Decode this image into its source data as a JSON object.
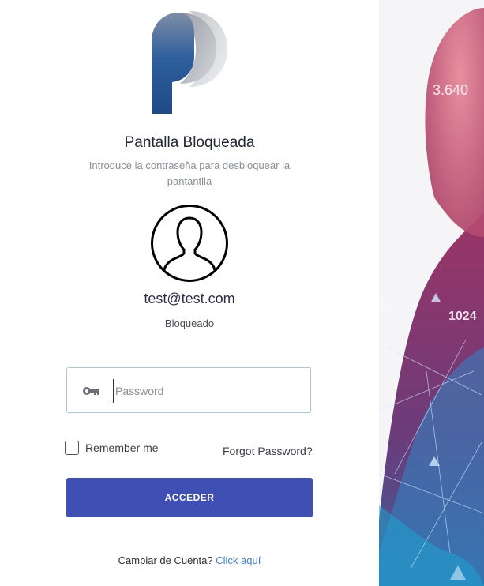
{
  "lock_screen": {
    "title": "Pantalla Bloqueada",
    "subtitle": "Introduce la contraseña para desbloquear la pantantlla",
    "email": "test@test.com",
    "status": "Bloqueado",
    "password_placeholder": "Password",
    "remember_label": "Remember me",
    "remember_checked": false,
    "forgot_label": "Forgot Password?",
    "submit_label": "ACCEDER",
    "switch_text": "Cambiar de Cuenta?",
    "switch_link": "Click aquí"
  },
  "side_image": {
    "overlay_texts": [
      "3.640",
      "36",
      "1024"
    ]
  },
  "colors": {
    "accent": "#3f4fb3",
    "link": "#3d7be0",
    "logo_dark": "#1f4f8a",
    "input_border": "#a9c4e4"
  },
  "icons": {
    "logo": "p-logo-icon",
    "avatar": "user-avatar-icon",
    "password": "key-icon"
  }
}
